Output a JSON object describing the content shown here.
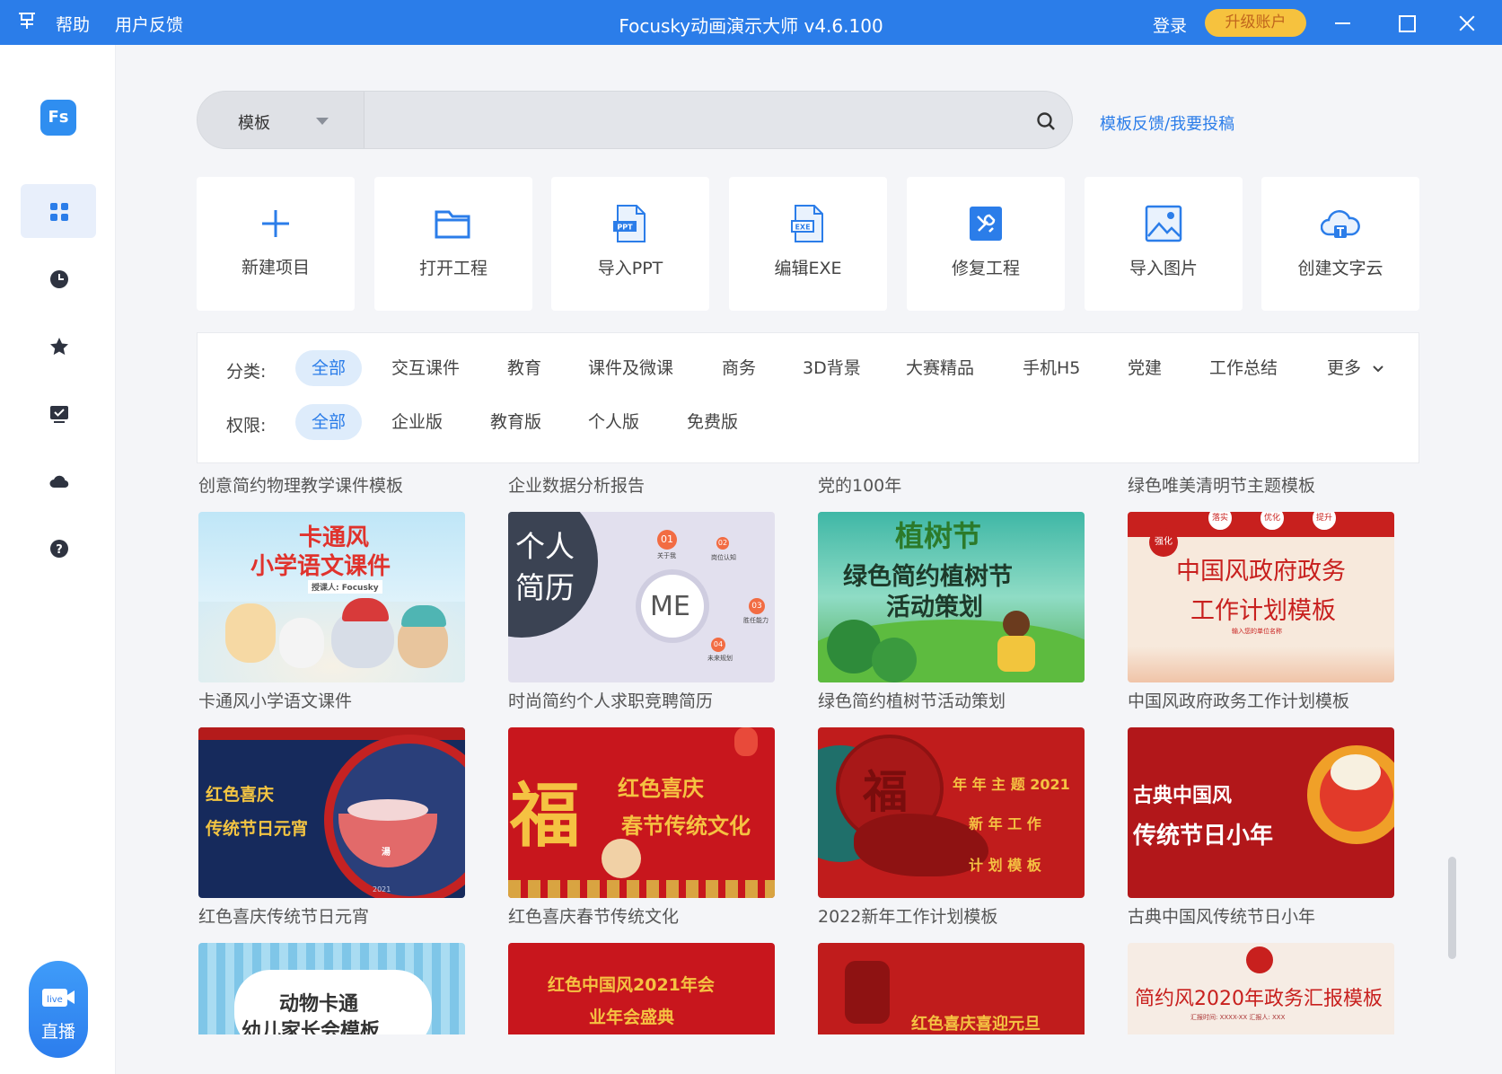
{
  "titlebar": {
    "menu": [
      "帮助",
      "用户反馈"
    ],
    "title": "Focusky动画演示大师 v4.6.100",
    "login": "登录",
    "upgrade": "升级账户"
  },
  "sidebar": {
    "logo": "Fs",
    "items": [
      {
        "icon": "grid-icon",
        "active": true
      },
      {
        "icon": "clock-icon",
        "active": false
      },
      {
        "icon": "star-icon",
        "active": false
      },
      {
        "icon": "task-icon",
        "active": false
      },
      {
        "icon": "cloud-icon",
        "active": false
      },
      {
        "icon": "help-icon",
        "active": false
      }
    ],
    "live": {
      "badge": "live",
      "label": "直播"
    }
  },
  "search": {
    "type": "模板",
    "placeholder": "",
    "feedback_link": "模板反馈/我要投稿"
  },
  "actions": [
    {
      "label": "新建项目",
      "icon": "plus-icon"
    },
    {
      "label": "打开工程",
      "icon": "folder-icon"
    },
    {
      "label": "导入PPT",
      "icon": "ppt-file-icon",
      "badge": "PPT"
    },
    {
      "label": "编辑EXE",
      "icon": "exe-file-icon",
      "badge": "EXE"
    },
    {
      "label": "修复工程",
      "icon": "repair-icon"
    },
    {
      "label": "导入图片",
      "icon": "image-icon"
    },
    {
      "label": "创建文字云",
      "icon": "word-cloud-icon"
    }
  ],
  "filters": {
    "category_label": "分类:",
    "categories": [
      "全部",
      "交互课件",
      "教育",
      "课件及微课",
      "商务",
      "3D背景",
      "大赛精品",
      "手机H5",
      "党建",
      "工作总结"
    ],
    "more": "更多",
    "permission_label": "权限:",
    "permissions": [
      "全部",
      "企业版",
      "教育版",
      "个人版",
      "免费版"
    ]
  },
  "templates": {
    "row0_titles": [
      "创意简约物理教学课件模板",
      "企业数据分析报告",
      "党的100年",
      "绿色唯美清明节主题模板"
    ],
    "row1_titles": [
      "卡通风小学语文课件",
      "时尚简约个人求职竞聘简历",
      "绿色简约植树节活动策划",
      "中国风政府政务工作计划模板"
    ],
    "row2_titles": [
      "红色喜庆传统节日元宵",
      "红色喜庆春节传统文化",
      "2022新年工作计划模板",
      "古典中国风传统节日小年"
    ],
    "thumbs_row1": [
      {
        "lines": [
          "卡通风",
          "小学语文课件"
        ],
        "sub": "授课人: Focusky"
      },
      {
        "lines": [
          "个人",
          "简历"
        ],
        "center": "ME",
        "nodes": [
          "01",
          "02",
          "03",
          "04"
        ],
        "node_labels": [
          "关于我",
          "岗位认知",
          "胜任能力",
          "未来规划"
        ]
      },
      {
        "lines": [
          "植树节",
          "绿色简约植树节",
          "活动策划"
        ]
      },
      {
        "lines": [
          "中国风政府政务",
          "工作计划模板"
        ],
        "tags": [
          "强化",
          "落实",
          "优化",
          "提升"
        ],
        "sub": "输入您的单位名称"
      }
    ],
    "thumbs_row2": [
      {
        "lines": [
          "红色喜庆",
          "传统节日元宵"
        ],
        "bowl": "湯",
        "sub": "2021"
      },
      {
        "lines": [
          "福",
          "红色喜庆",
          "春节传统文化"
        ]
      },
      {
        "lines": [
          "福",
          "年 年 主 题 2021",
          "新 年 工 作",
          "计 划 模 板"
        ]
      },
      {
        "lines": [
          "古典中国风",
          "传统节日小年"
        ]
      }
    ],
    "thumbs_row3": [
      {
        "lines": [
          "动物卡通",
          "幼儿家长会模板"
        ]
      },
      {
        "lines": [
          "红色中国风2021年会",
          "业年会盛典"
        ]
      },
      {
        "lines": [
          "红色喜庆喜迎元旦"
        ]
      },
      {
        "lines": [
          "简约风2020年政务汇报模板"
        ],
        "sub": "汇报时间: XXXX-XX  汇报人: XXX"
      }
    ]
  },
  "colors": {
    "brand": "#2b7de9",
    "upgrade": "#f6c23e",
    "active_chip_bg": "#deecfb"
  }
}
